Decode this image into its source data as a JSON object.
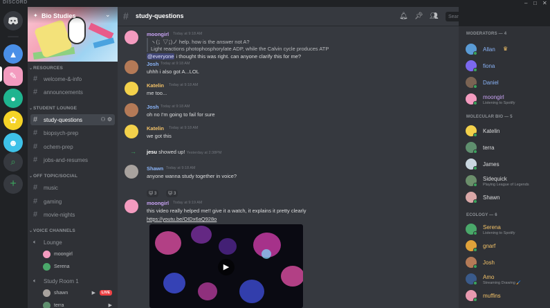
{
  "window": {
    "brand": "DISCORD"
  },
  "server": {
    "name": "Bio Studies"
  },
  "header": {
    "channel": "study-questions",
    "search_placeholder": "Search"
  },
  "categories": {
    "resources": "RESOURCES",
    "student_lounge": "STUDENT LOUNGE",
    "off_topic": "OFF TOPIC/SOCIAL",
    "voice": "VOICE CHANNELS"
  },
  "channels": {
    "welcome": "welcome-&-info",
    "announcements": "announcements",
    "study_questions": "study-questions",
    "biopsych": "biopsych-prep",
    "ochem": "ochem-prep",
    "jobs": "jobs-and-resumes",
    "music": "music",
    "gaming": "gaming",
    "movie": "movie-nights"
  },
  "voice": {
    "lounge": "Lounge",
    "lounge_users": [
      "moongirl",
      "Serena"
    ],
    "study_room": "Study Room 1",
    "study_users": [
      "shawn",
      "terra"
    ],
    "live_badge": "LIVE"
  },
  "messages": {
    "m1": {
      "author": "moongirl",
      "ts": "Today at 9:18 AM",
      "l1": "ヽ(；▽；)ノ help. how is the answer not A?",
      "l2": "Light reactions photophosphorylate ADP, while the Calvin cycle produces ATP",
      "l3_mention": "@everyone",
      "l3": " i thought this was right. can anyone clarify this for me?"
    },
    "m2": {
      "author": "Josh",
      "ts": "Today at 9:18 AM",
      "text": "uhhh i also got A...LOL"
    },
    "m3": {
      "author": "Katelin",
      "ts": "Today at 9:18 AM",
      "text": "me too..."
    },
    "m4": {
      "author": "Josh",
      "ts": "Today at 9:18 AM",
      "text": "oh no I'm going to fail for sure"
    },
    "m5": {
      "author": "Katelin",
      "ts": "Today at 9:18 AM",
      "text": "we got this"
    },
    "sys": {
      "user": "jesu",
      "text": " showed up!",
      "ts": "Yesterday at 2:38PM"
    },
    "m6": {
      "author": "Shawn",
      "ts": "Today at 9:18 AM",
      "text": "anyone wanna study together in voice?",
      "r1": "3",
      "r2": "3"
    },
    "m7": {
      "author": "moongirl",
      "ts": "Today at 9:19 AM",
      "text": "this video really helped me!! give it a watch, it explains it pretty clearly",
      "link": "https://youtu.be/OIDx6aQ928o"
    }
  },
  "members": {
    "moderators": "MODERATORS — 4",
    "molecular": "MOLECULAR BIO — 5",
    "ecology": "ECOLOGY — 6",
    "allan": "Allan",
    "fiona": "fiona",
    "daniel": "Daniel",
    "moongirl": "moongirl",
    "moongirl_activity": "Listening to Spotify",
    "katelin": "Katelin",
    "terra": "terra",
    "james": "James",
    "sidequick": "Sidequick",
    "sidequick_activity": "Playing League of Legends",
    "shawn": "Shawn",
    "serena": "Serena",
    "serena_activity": "Listening to Spotify",
    "gnarf": "gnarf",
    "josh": "Josh",
    "amo": "Amo",
    "amo_activity": "Streaming Drawing 🖌️",
    "muffins": "muffins"
  },
  "colors": {
    "accent": "#5865f2",
    "online": "#3ba55d",
    "author_purple": "#c9a3f5",
    "author_blue": "#8ab4f8",
    "author_yellow": "#f3c268"
  }
}
